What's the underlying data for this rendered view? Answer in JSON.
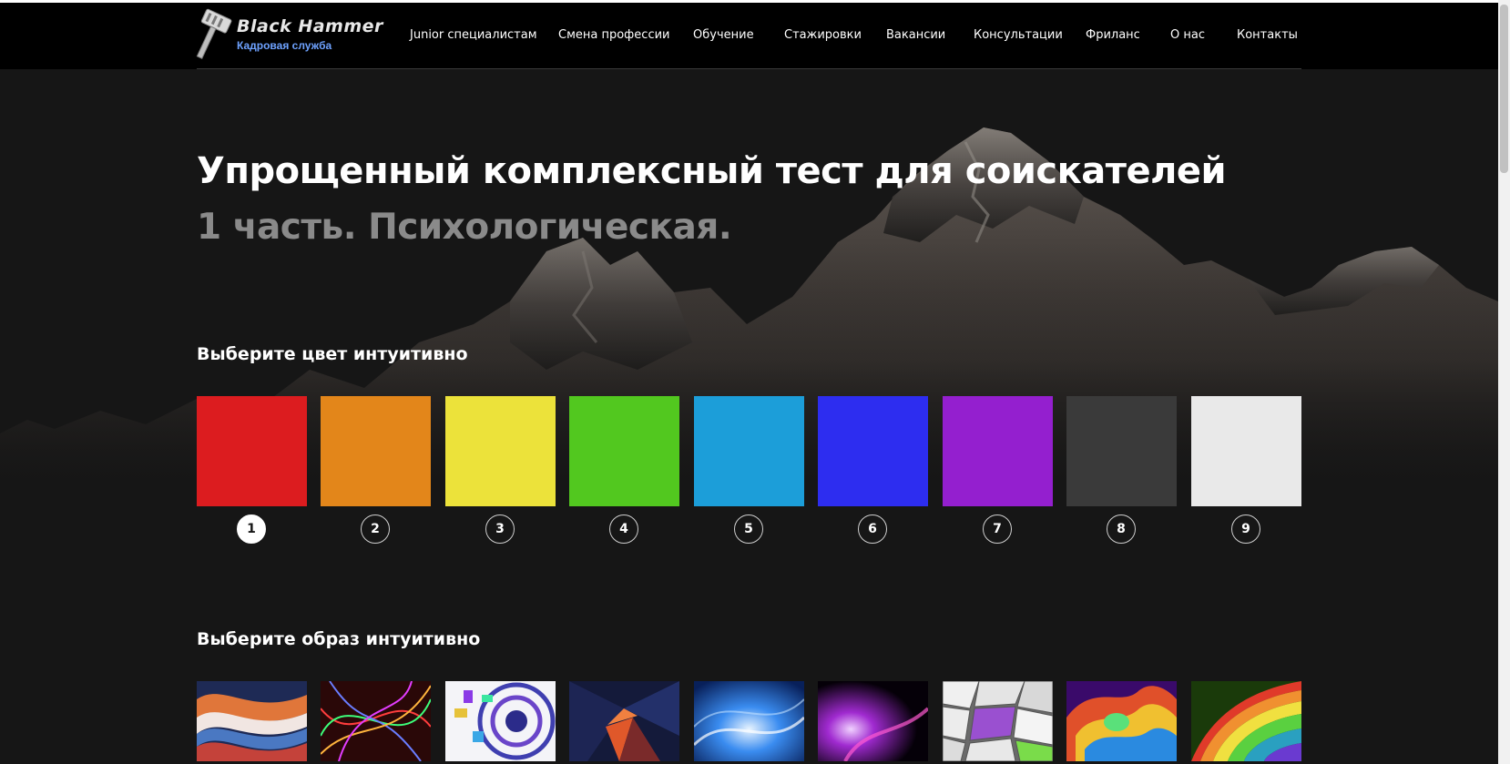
{
  "brand": {
    "title": "Black Hammer",
    "subtitle": "Кадровая служба"
  },
  "nav": [
    {
      "label": "Junior специалистам"
    },
    {
      "label": "Смена профессии"
    },
    {
      "label": "Обучение"
    },
    {
      "label": "Стажировки"
    },
    {
      "label": "Вакансии"
    },
    {
      "label": "Консультации"
    },
    {
      "label": "Фриланс"
    },
    {
      "label": "О нас"
    },
    {
      "label": "Контакты"
    }
  ],
  "hero": {
    "title": "Упрощенный комплексный тест для соискателей",
    "subtitle": "1 часть. Психологическая."
  },
  "colors_section": {
    "heading": "Выберите цвет интуитивно",
    "selected": 1,
    "swatches": [
      {
        "number": "1",
        "color": "#dc1c1f"
      },
      {
        "number": "2",
        "color": "#e3861a"
      },
      {
        "number": "3",
        "color": "#ece23a"
      },
      {
        "number": "4",
        "color": "#52c81f"
      },
      {
        "number": "5",
        "color": "#1c9ed9"
      },
      {
        "number": "6",
        "color": "#2d2df0"
      },
      {
        "number": "7",
        "color": "#941fcf"
      },
      {
        "number": "8",
        "color": "#3a3a3a"
      },
      {
        "number": "9",
        "color": "#e9e9e9"
      }
    ]
  },
  "images_section": {
    "heading": "Выберите образ интуитивно",
    "images": [
      {
        "name": "wavy-stripes-image"
      },
      {
        "name": "neon-lines-image"
      },
      {
        "name": "geometric-tunnel-image"
      },
      {
        "name": "dark-polygon-image"
      },
      {
        "name": "blue-swirl-image"
      },
      {
        "name": "purple-glow-image"
      },
      {
        "name": "cracked-tiles-image"
      },
      {
        "name": "fluid-colors-image"
      },
      {
        "name": "rainbow-layers-image"
      }
    ]
  }
}
